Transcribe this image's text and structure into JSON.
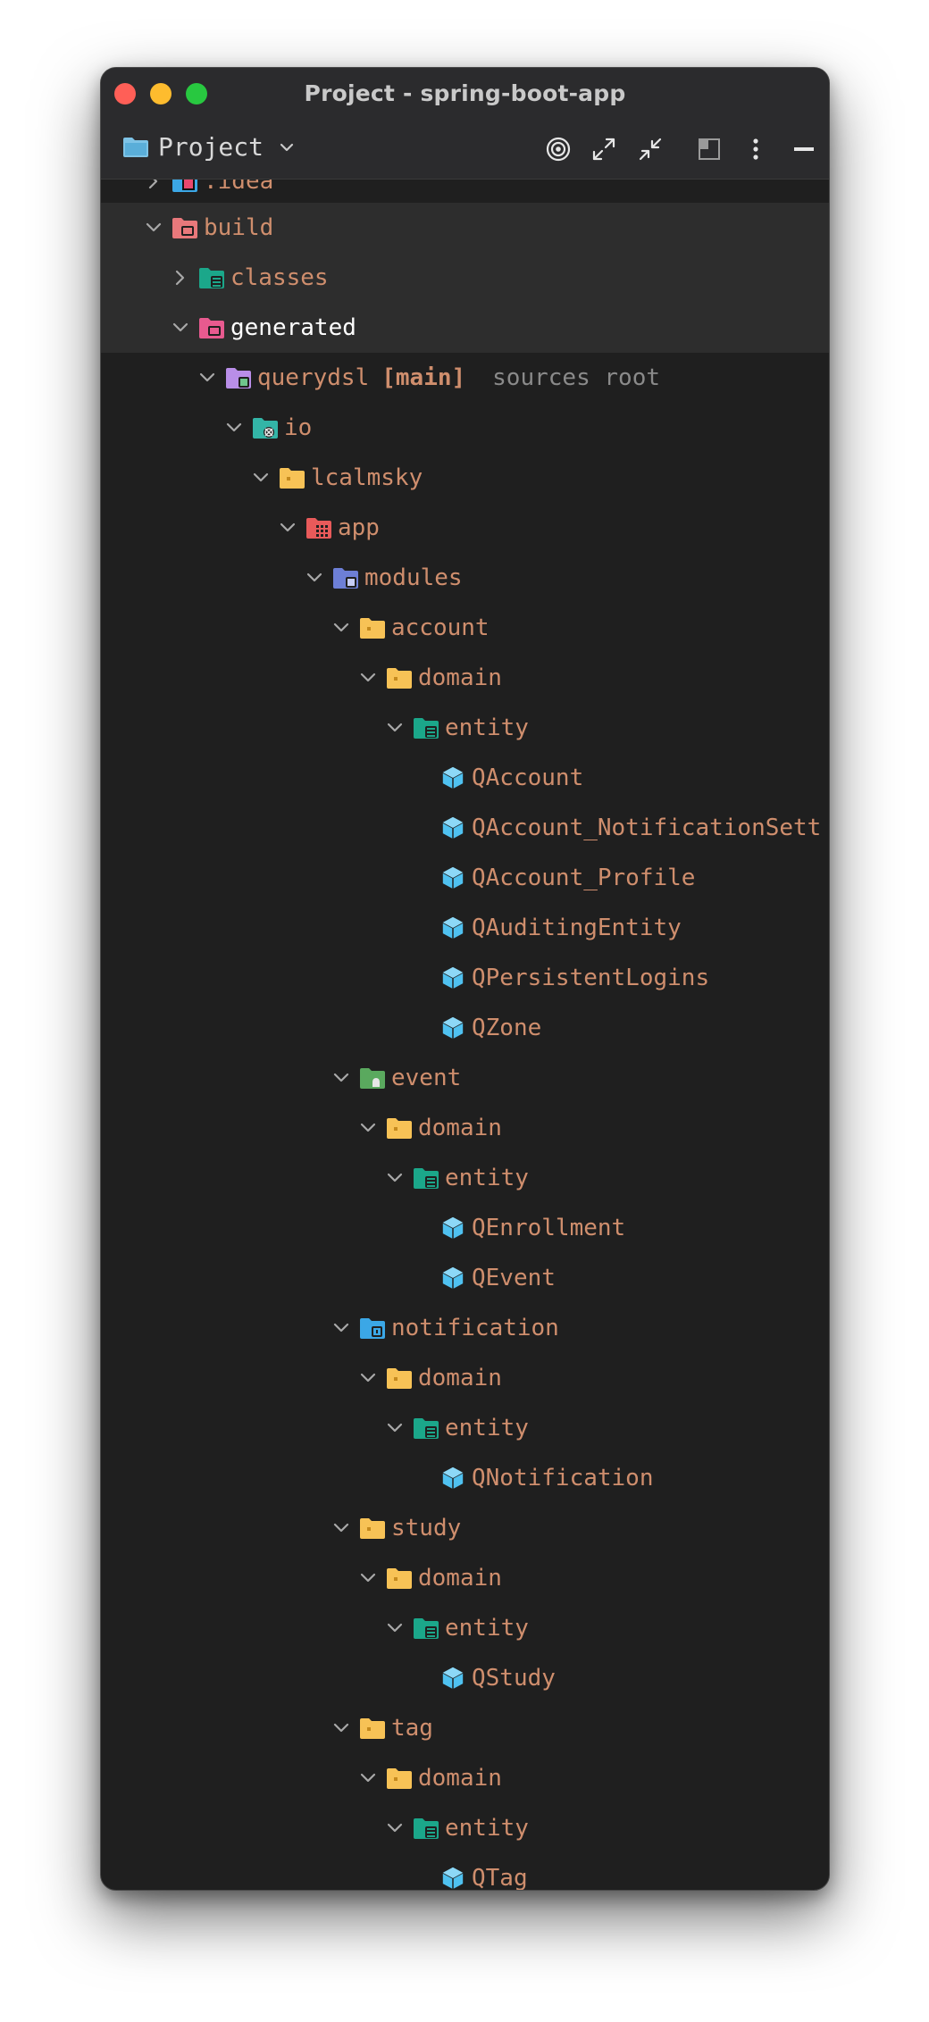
{
  "window": {
    "title": "Project - spring-boot-app"
  },
  "toolbar": {
    "view_label": "Project",
    "icons": [
      "target-icon",
      "expand-icon",
      "collapse-icon",
      "layout-icon",
      "more-icon",
      "minimize-icon"
    ]
  },
  "colors": {
    "background": "#1f1f1f",
    "titlebar": "#2b2b2d",
    "label": "#cf8e6d",
    "selected_label": "#ffffff",
    "hint": "#8a8a8a",
    "class_icon": "#4fc1f0",
    "folder_yellow": "#f7c256"
  },
  "tree": {
    "idea": ".idea",
    "build": "build",
    "classes": "classes",
    "generated": "generated",
    "querydsl": "querydsl",
    "querydsl_tag": "[main]",
    "querydsl_hint": "sources root",
    "io": "io",
    "lcalmsky": "lcalmsky",
    "app": "app",
    "modules": "modules",
    "account": "account",
    "account_domain": "domain",
    "account_entity": "entity",
    "account_classes": [
      "QAccount",
      "QAccount_NotificationSett",
      "QAccount_Profile",
      "QAuditingEntity",
      "QPersistentLogins",
      "QZone"
    ],
    "event": "event",
    "event_domain": "domain",
    "event_entity": "entity",
    "event_classes": [
      "QEnrollment",
      "QEvent"
    ],
    "notification": "notification",
    "notification_domain": "domain",
    "notification_entity": "entity",
    "notification_classes": [
      "QNotification"
    ],
    "study": "study",
    "study_domain": "domain",
    "study_entity": "entity",
    "study_classes": [
      "QStudy"
    ],
    "tag": "tag",
    "tag_domain": "domain",
    "tag_entity": "entity",
    "tag_classes": [
      "QTag"
    ]
  }
}
